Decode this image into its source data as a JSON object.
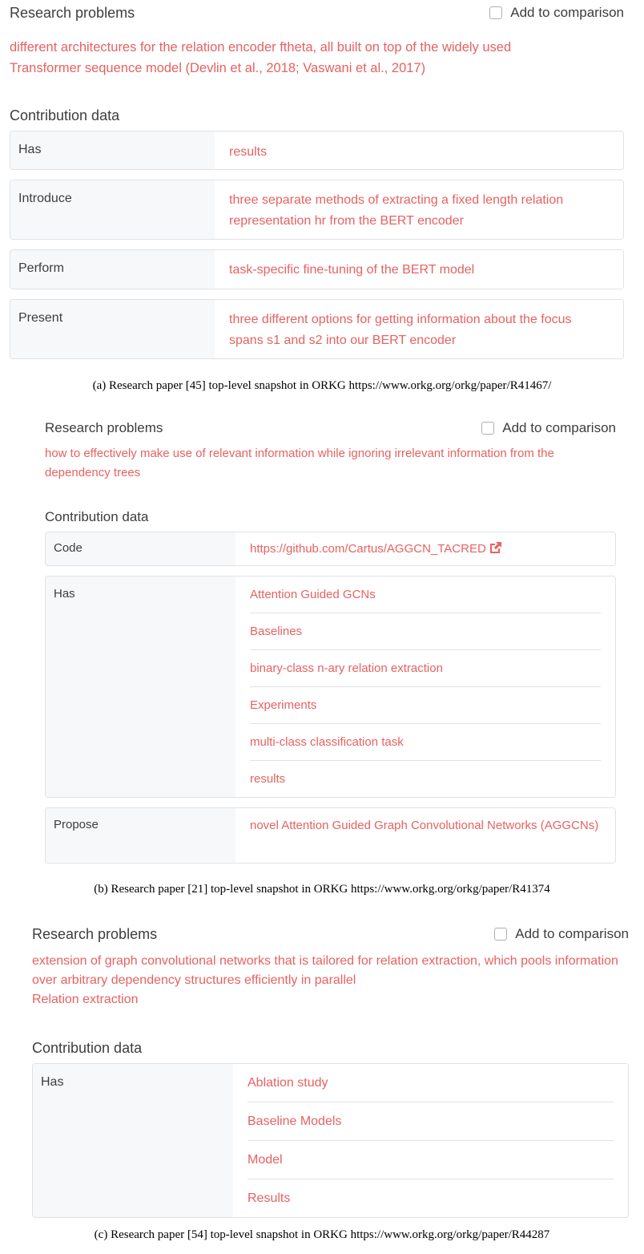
{
  "panels": [
    {
      "research_problems_label": "Research problems",
      "add_to_comparison_label": "Add to comparison",
      "problems": [
        "different architectures for the relation encoder ftheta, all built on top of the widely used",
        "Transformer sequence model (Devlin et al., 2018; Vaswani et al., 2017)"
      ],
      "contribution_label": "Contribution data",
      "rows": [
        {
          "key": "Has",
          "values": [
            "results"
          ]
        },
        {
          "key": "Introduce",
          "values": [
            "three separate methods of extracting a fixed length relation representation hr from the BERT encoder"
          ]
        },
        {
          "key": "Perform",
          "values": [
            "task-specific fine-tuning of the BERT model"
          ]
        },
        {
          "key": "Present",
          "values": [
            "three different options for getting information about the focus spans s1 and s2 into our BERT encoder"
          ]
        }
      ],
      "caption": "(a)  Research paper [45] top-level snapshot in ORKG https://www.orkg.org/orkg/paper/R41467/"
    },
    {
      "research_problems_label": "Research problems",
      "add_to_comparison_label": "Add to comparison",
      "problems": [
        "how to effectively make use of relevant information while ignoring irrelevant information from the dependency trees"
      ],
      "contribution_label": "Contribution data",
      "rows": [
        {
          "key": "Code",
          "values": [
            "https://github.com/Cartus/AGGCN_TACRED"
          ],
          "external_link": true
        },
        {
          "key": "Has",
          "values": [
            "Attention Guided GCNs",
            "Baselines",
            "binary-class n-ary relation extraction",
            "Experiments",
            "multi-class classification task",
            "results"
          ]
        },
        {
          "key": "Propose",
          "values": [
            "novel Attention Guided Graph Convolutional Networks (AGGCNs)"
          ]
        }
      ],
      "caption": "(b)  Research paper [21] top-level snapshot in ORKG https://www.orkg.org/orkg/paper/R41374"
    },
    {
      "research_problems_label": "Research problems",
      "add_to_comparison_label": "Add to comparison",
      "problems": [
        "extension of graph convolutional networks that is tailored for relation extraction, which pools information over arbitrary dependency structures efficiently in parallel",
        "Relation extraction"
      ],
      "contribution_label": "Contribution data",
      "rows": [
        {
          "key": "Has",
          "values": [
            "Ablation study",
            "Baseline Models",
            "Model",
            "Results"
          ]
        }
      ],
      "caption": "(c)  Research paper [54] top-level snapshot in ORKG https://www.orkg.org/orkg/paper/R44287"
    }
  ],
  "colors": {
    "accent": "#e86161",
    "key_bg": "#f7f8fa",
    "border": "#dfe2e6"
  },
  "icons": {
    "external_link": "external-link-icon",
    "checkbox": "checkbox-icon"
  }
}
